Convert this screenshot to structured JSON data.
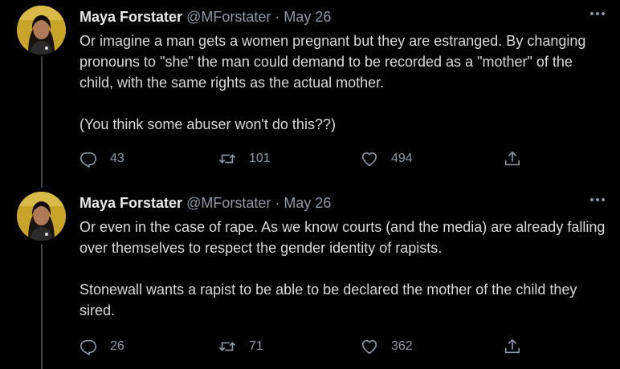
{
  "tweets": [
    {
      "author_name": "Maya Forstater",
      "handle": "@MForstater",
      "separator": "·",
      "date": "May 26",
      "paragraphs": [
        "Or imagine a man gets a women pregnant but they are estranged. By changing pronouns to \"she\" the man could demand to be recorded as a \"mother\" of the child, with the same rights as the actual mother.",
        "(You think some abuser won't do this??)"
      ],
      "replies": "43",
      "retweets": "101",
      "likes": "494"
    },
    {
      "author_name": "Maya Forstater",
      "handle": "@MForstater",
      "separator": "·",
      "date": "May 26",
      "paragraphs": [
        "Or even in the case of rape. As we know courts (and the media) are already falling over themselves to respect the gender identity of rapists.",
        "Stonewall wants a rapist to be able to be declared the mother of the child they sired."
      ],
      "replies": "26",
      "retweets": "71",
      "likes": "362"
    }
  ],
  "icons": {
    "more": "more-horizontal-icon",
    "reply": "reply-icon",
    "retweet": "retweet-icon",
    "like": "heart-icon",
    "share": "share-icon"
  },
  "colors": {
    "background": "#000000",
    "text": "#d9d9d9",
    "secondary": "#8b98a5",
    "thread_line": "#3d4246"
  }
}
